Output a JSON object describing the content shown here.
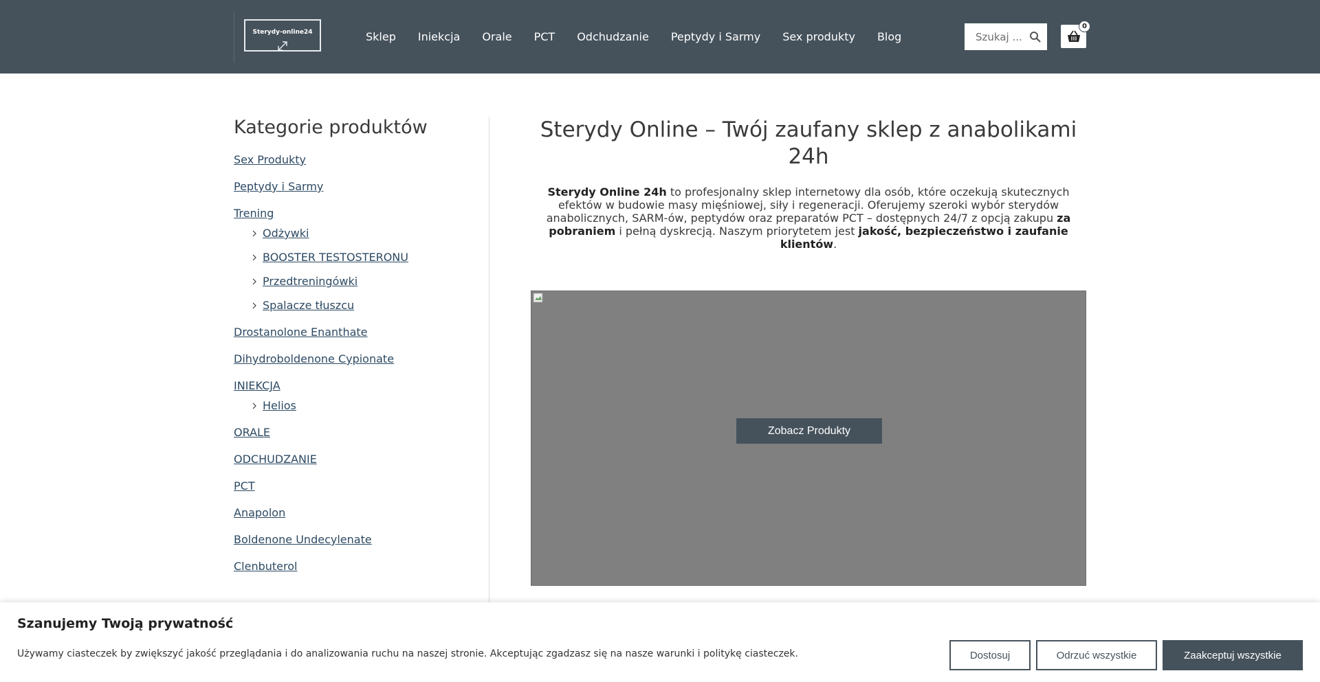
{
  "header": {
    "logo_text": "Sterydy-online24",
    "nav": [
      "Sklep",
      "Iniekcja",
      "Orale",
      "PCT",
      "Odchudzanie",
      "Peptydy i Sarmy",
      "Sex produkty",
      "Blog"
    ],
    "search_placeholder": "Szukaj ...",
    "cart_count": "0"
  },
  "sidebar": {
    "title": "Kategorie produktów",
    "cat_sex": "Sex Produkty",
    "cat_peptydy": "Peptydy i Sarmy",
    "cat_trening": "Trening",
    "trening_sub": [
      "Odżywki",
      "BOOSTER TESTOSTERONU",
      "Przedtreningówki",
      "Spalacze tłuszcu"
    ],
    "cat_drostanolone": "Drostanolone Enanthate",
    "cat_dihydro": "Dihydroboldenone Cypionate",
    "cat_iniekcja": "INIEKCJA",
    "iniekcja_sub": [
      "Helios"
    ],
    "cat_orale": "ORALE",
    "cat_odchudzanie": "ODCHUDZANIE",
    "cat_pct": "PCT",
    "cat_anapolon": "Anapolon",
    "cat_boldenone": "Boldenone Undecylenate",
    "cat_clenbuterol": "Clenbuterol"
  },
  "main": {
    "title": "Sterydy Online – Twój zaufany sklep z anabolikami 24h",
    "intro": {
      "brand": "Sterydy Online 24h",
      "part1": " to profesjonalny sklep internetowy dla osób, które oczekują skutecznych efektów w budowie masy mięśniowej, siły i regeneracji. Oferujemy szeroki wybór sterydów anabolicznych, SARM-ów, peptydów oraz preparatów PCT – dostępnych 24/7 z opcją zakupu ",
      "bold1": "za pobraniem",
      "part2": " i pełną dyskrecją. Naszym priorytetem jest ",
      "bold2": "jakość, bezpieczeństwo i zaufanie klientów",
      "part3": "."
    },
    "hero_button": "Zobacz Produkty"
  },
  "cookie": {
    "title": "Szanujemy Twoją prywatność",
    "text": "Używamy ciasteczek by zwiększyć jakość przeglądania i do analizowania ruchu na naszej stronie. Akceptując zgadzasz się na nasze warunki i politykę ciasteczek.",
    "customize": "Dostosuj",
    "reject": "Odrzuć wszystkie",
    "accept": "Zaakceptuj wszystkie"
  },
  "colors": {
    "header_bg": "#45525c",
    "link": "#2d4a63",
    "hero_bg": "#808080"
  }
}
